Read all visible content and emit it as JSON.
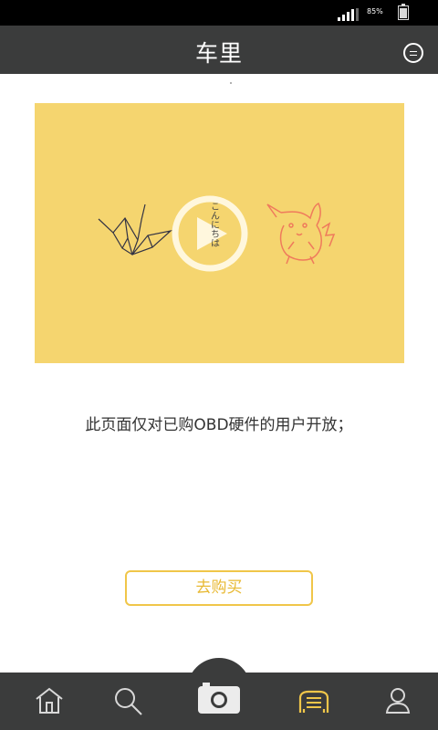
{
  "status_bar": {
    "battery_percent": "85%",
    "signal_icon": "signal-bars-icon",
    "battery_icon": "battery-icon"
  },
  "header": {
    "title": "车里",
    "menu_icon": "menu-icon"
  },
  "banner": {
    "play_icon": "play-icon",
    "left_illustration": "origami-crane-icon",
    "right_illustration": "pikachu-sketch-icon",
    "japanese_text": "こんにちは",
    "background": "#f5d56f"
  },
  "content": {
    "message": "此页面仅对已购OBD硬件的用户开放；",
    "buy_button": "去购买"
  },
  "bottom_nav": {
    "items": [
      {
        "icon": "home-icon",
        "active": false
      },
      {
        "icon": "search-icon",
        "active": false
      },
      {
        "icon": "camera-icon",
        "active": false
      },
      {
        "icon": "car-list-icon",
        "active": true
      },
      {
        "icon": "user-icon",
        "active": false
      }
    ],
    "active_color": "#f0c649",
    "inactive_color": "#d8d8d8"
  }
}
